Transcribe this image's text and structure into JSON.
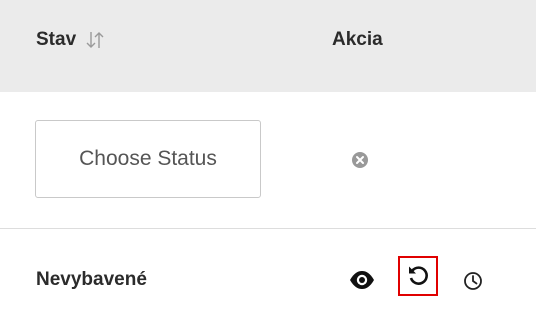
{
  "table": {
    "columns": {
      "status_header": "Stav",
      "action_header": "Akcia"
    },
    "filters": {
      "status_placeholder": "Choose Status"
    },
    "rows": [
      {
        "status": "Nevybavené"
      }
    ]
  },
  "icons": {
    "sort": "sort-arrows-icon",
    "clear": "clear-circle-icon",
    "view": "eye-icon",
    "undo": "undo-icon",
    "history": "clock-icon"
  },
  "colors": {
    "header_bg": "#ebebeb",
    "highlight": "#e00000",
    "text": "#2b2b2b",
    "icon_muted": "#999999"
  }
}
